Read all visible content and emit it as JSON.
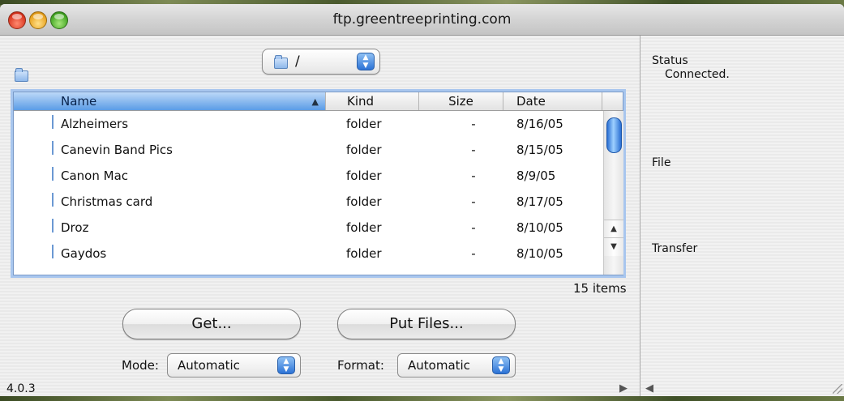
{
  "window": {
    "title": "ftp.greentreeprinting.com"
  },
  "path": {
    "label": "/"
  },
  "table": {
    "columns": [
      "Name",
      "Kind",
      "Size",
      "Date"
    ],
    "sort_indicator": "▲",
    "rows": [
      {
        "name": "Alzheimers",
        "kind": "folder",
        "size": "-",
        "date": "8/16/05"
      },
      {
        "name": "Canevin Band Pics",
        "kind": "folder",
        "size": "-",
        "date": "8/15/05"
      },
      {
        "name": "Canon Mac",
        "kind": "folder",
        "size": "-",
        "date": "8/9/05"
      },
      {
        "name": "Christmas card",
        "kind": "folder",
        "size": "-",
        "date": "8/17/05"
      },
      {
        "name": "Droz",
        "kind": "folder",
        "size": "-",
        "date": "8/10/05"
      },
      {
        "name": "Gaydos",
        "kind": "folder",
        "size": "-",
        "date": "8/10/05"
      }
    ],
    "item_count": "15 items"
  },
  "actions": {
    "get_label": "Get...",
    "put_label": "Put Files..."
  },
  "options": {
    "mode_label": "Mode:",
    "mode_value": "Automatic",
    "format_label": "Format:",
    "format_value": "Automatic"
  },
  "footer": {
    "version": "4.0.3"
  },
  "side": {
    "status_label": "Status",
    "status_value": "Connected.",
    "file_label": "File",
    "transfer_label": "Transfer"
  },
  "colors": {
    "accent": "#5b9ce6",
    "scroll_thumb": "#2a6fd3",
    "close": "#d8321c",
    "minimize": "#e8a01a",
    "zoom": "#3fa31f"
  }
}
